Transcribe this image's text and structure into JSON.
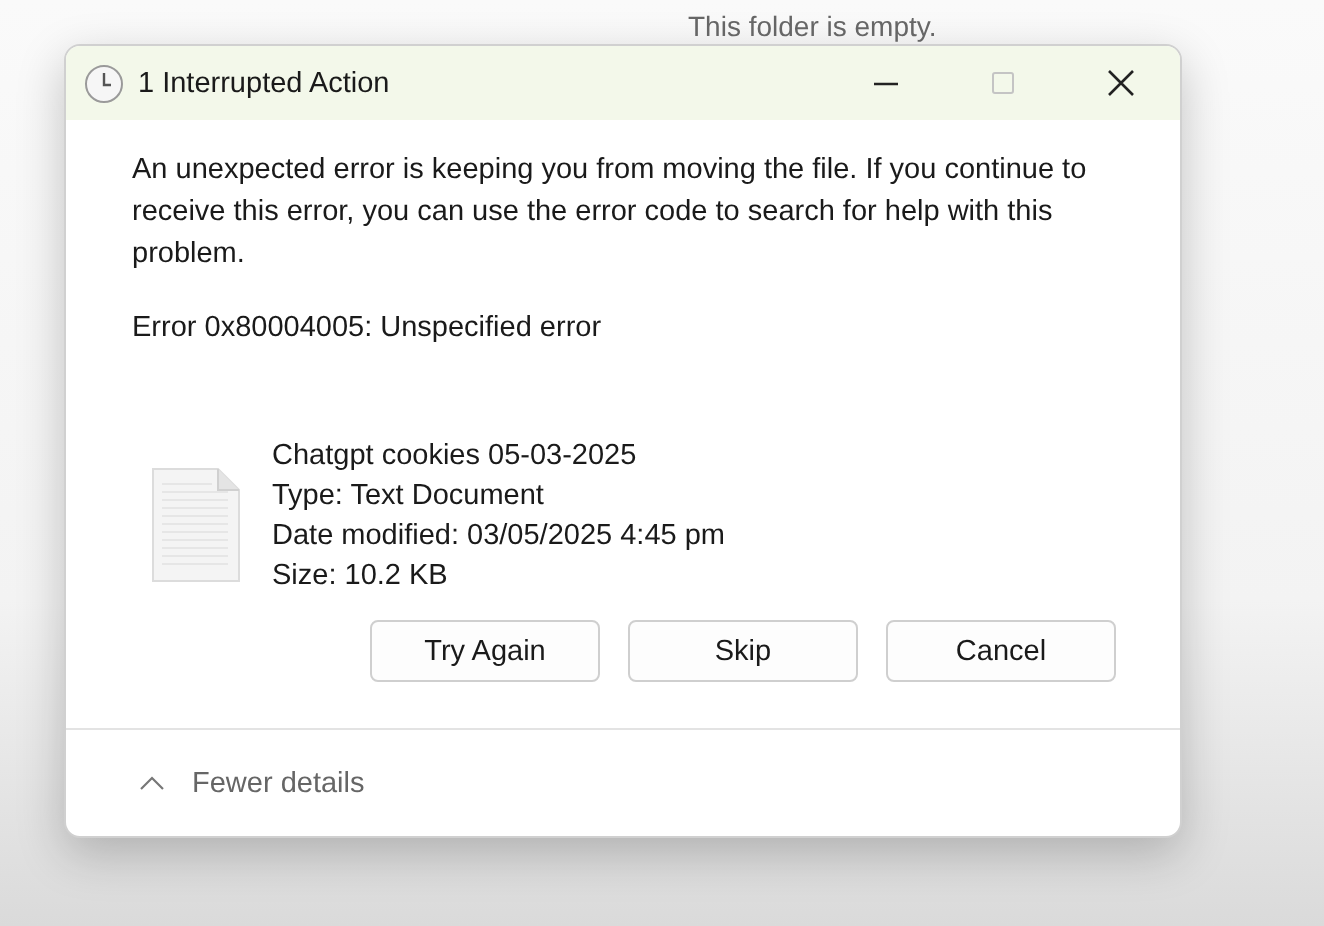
{
  "background": {
    "text": "This folder is empty."
  },
  "window": {
    "title": "1 Interrupted Action"
  },
  "message": "An unexpected error is keeping you from moving the file. If you continue to receive this error, you can use the error code to search for help with this problem.",
  "error": "Error 0x80004005: Unspecified error",
  "file": {
    "name": "Chatgpt cookies 05-03-2025",
    "type": "Type: Text Document",
    "modified": "Date modified: 03/05/2025 4:45 pm",
    "size": "Size: 10.2 KB"
  },
  "buttons": [
    "Try Again",
    "Skip",
    "Cancel"
  ],
  "details_toggle": {
    "label": "Fewer details",
    "expanded": true
  }
}
